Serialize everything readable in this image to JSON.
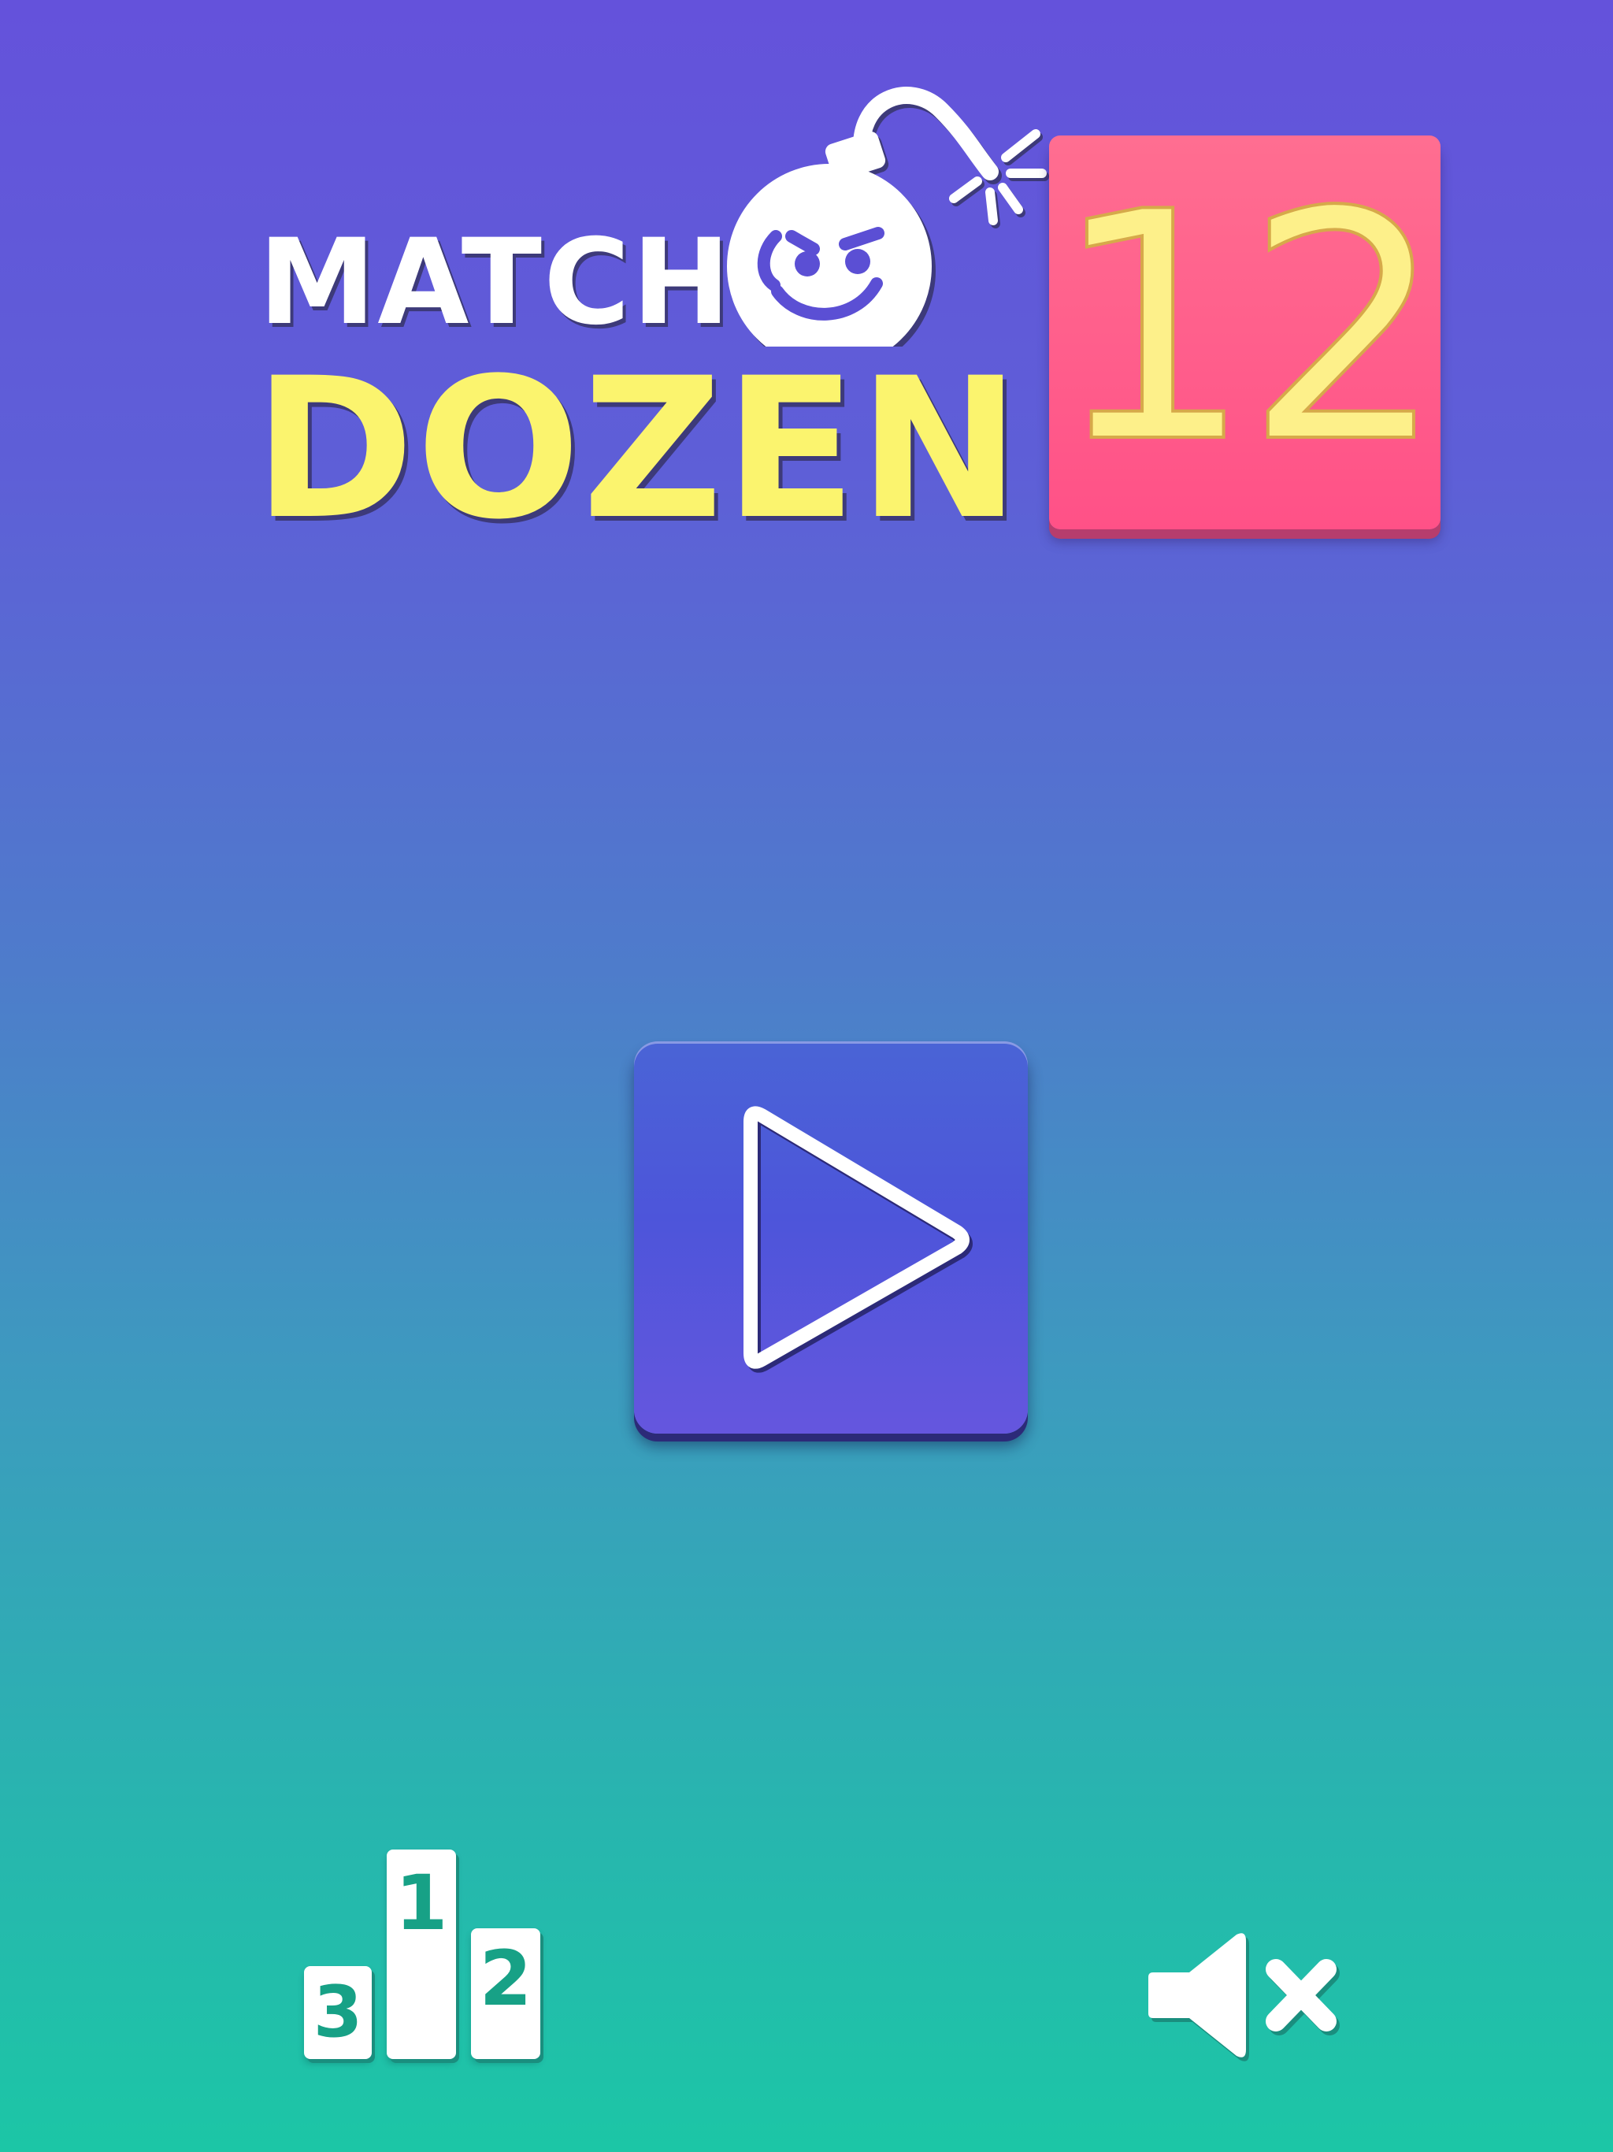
{
  "logo": {
    "line1": "MATCH",
    "line2": "DOZEN",
    "tile_number": "12",
    "bomb_icon": "bomb-icon"
  },
  "colors": {
    "background_top": "#6452DB",
    "background_bottom": "#1CC6A6",
    "logo_match": "#FFFFFF",
    "logo_dozen": "#FBF46E",
    "tile_12": "#FF5187",
    "tile_12_digits": "#FDF08A",
    "play_button": "#4D55DA",
    "podium_digits": "#17A186"
  },
  "controls": {
    "play_icon": "play-icon",
    "leaderboard_icon": "podium-icon",
    "sound_icon": "speaker-muted-icon",
    "podium": {
      "first": "1",
      "second": "2",
      "third": "3"
    }
  }
}
